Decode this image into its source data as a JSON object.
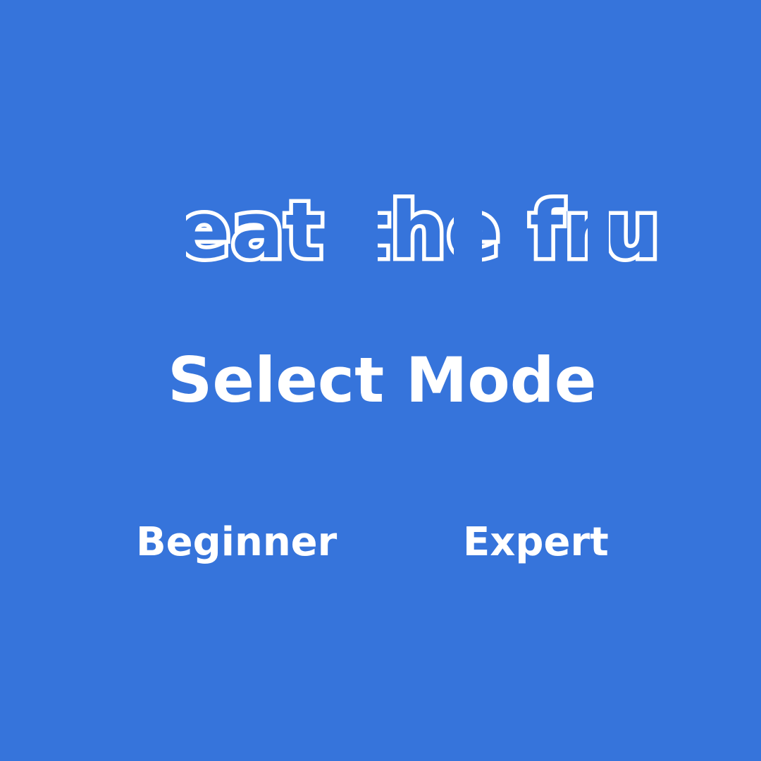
{
  "game": {
    "logo_text": "eat the fruit",
    "screen_title": "Select Mode",
    "modes": [
      {
        "label": "Beginner"
      },
      {
        "label": "Expert"
      }
    ]
  },
  "colors": {
    "background": "#3674db",
    "text": "#ffffff"
  }
}
